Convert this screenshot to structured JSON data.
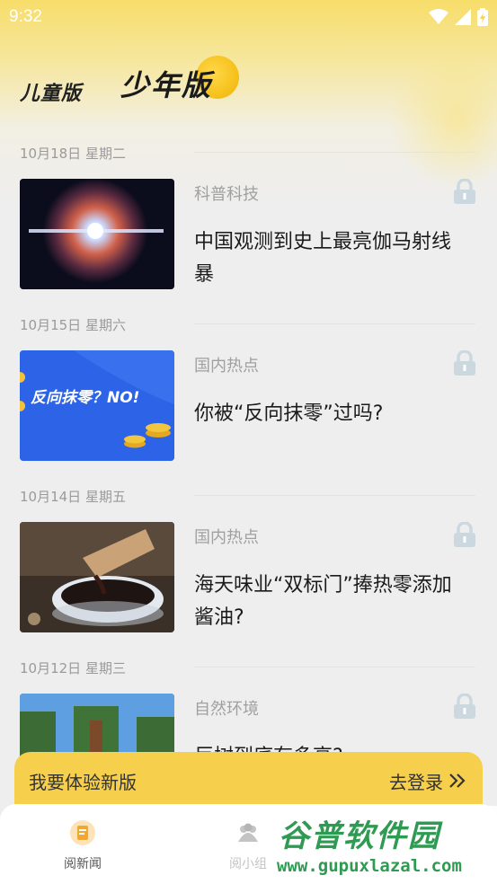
{
  "status_bar": {
    "time": "9:32"
  },
  "tabs": {
    "kids": "儿童版",
    "teen": "少年版"
  },
  "articles": [
    {
      "date": "10月18日 星期二",
      "category": "科普科技",
      "title": "中国观测到史上最亮伽马射线暴"
    },
    {
      "date": "10月15日 星期六",
      "category": "国内热点",
      "title": "你被“反向抹零”过吗?",
      "thumb_text": "反向抹零？NO!"
    },
    {
      "date": "10月14日 星期五",
      "category": "国内热点",
      "title": "海天味业“双标门”捧热零添加酱油?"
    },
    {
      "date": "10月12日 星期三",
      "category": "自然环境",
      "title": "巨树到底有多高?"
    }
  ],
  "banner": {
    "text": "我要体验新版",
    "action": "去登录"
  },
  "bottom_nav": [
    {
      "label": "阅新闻",
      "icon": "news-icon"
    },
    {
      "label": "阅小组",
      "icon": "group-icon"
    }
  ],
  "watermark": {
    "name": "谷普软件园",
    "url": "www.gupuxlazal.com"
  },
  "colors": {
    "accent": "#f6cf4c",
    "lock": "#cbd8df",
    "nav_active": "#f0a832"
  }
}
